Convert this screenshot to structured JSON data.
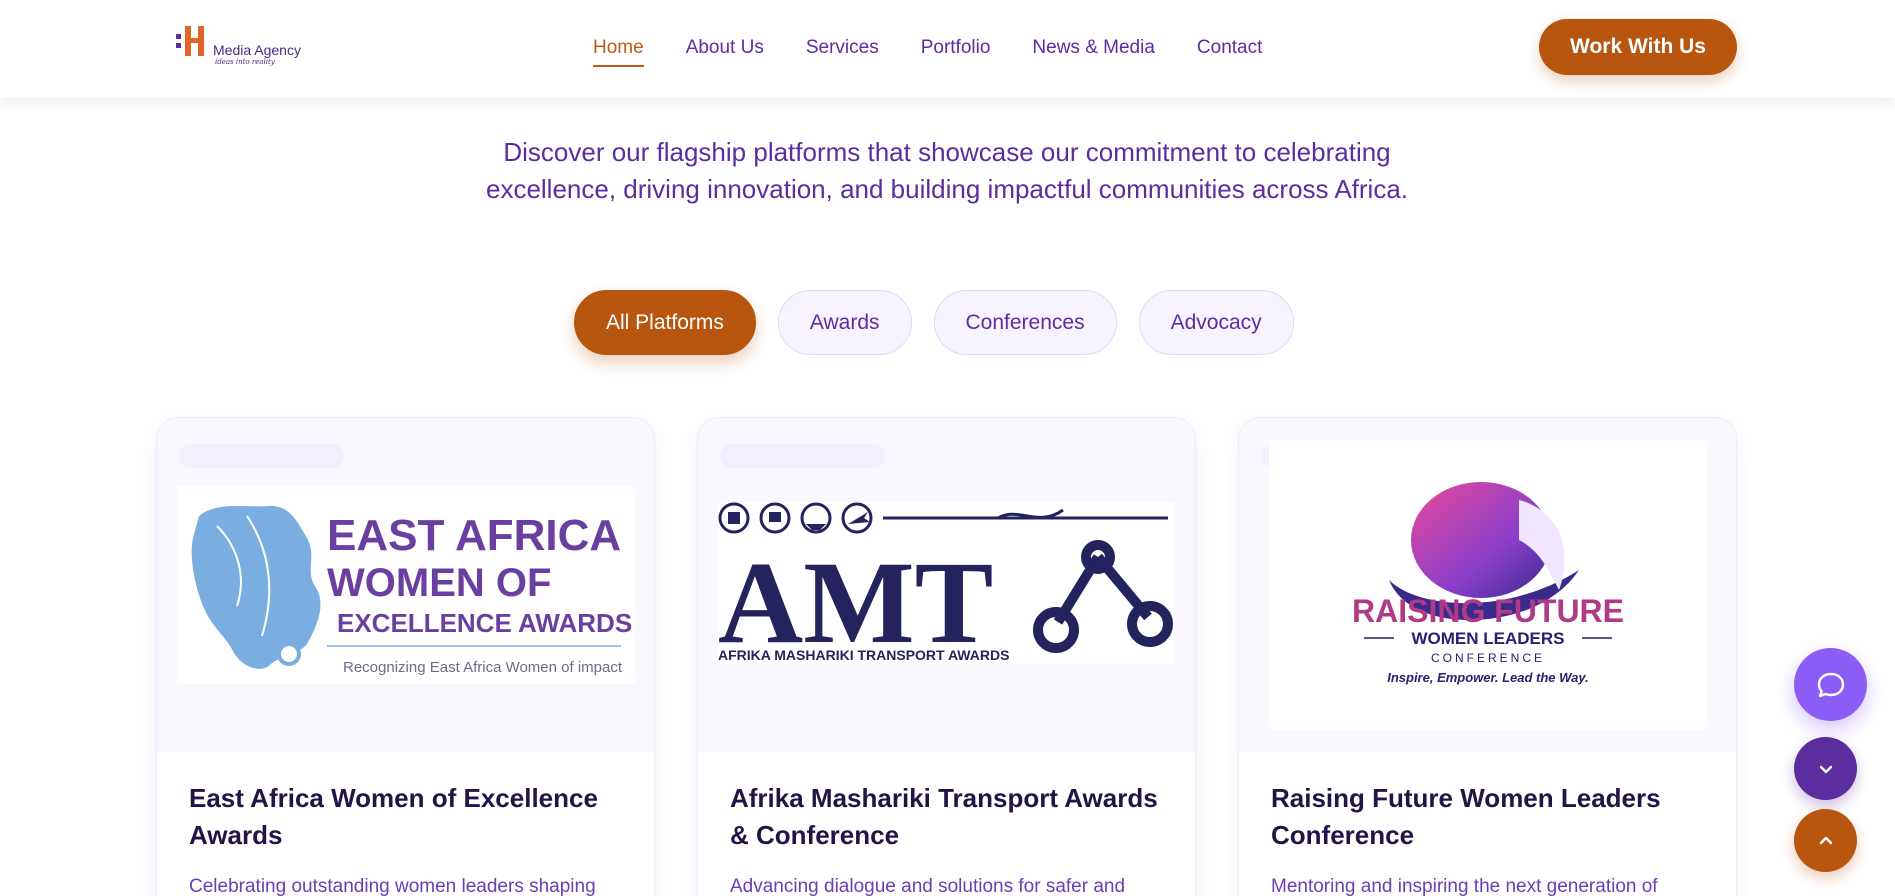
{
  "header": {
    "logo": {
      "name": "Media Agency",
      "tagline": "ideas into reality",
      "mark": "BH"
    },
    "nav": [
      {
        "label": "Home",
        "active": true
      },
      {
        "label": "About Us",
        "active": false
      },
      {
        "label": "Services",
        "active": false
      },
      {
        "label": "Portfolio",
        "active": false
      },
      {
        "label": "News & Media",
        "active": false
      },
      {
        "label": "Contact",
        "active": false
      }
    ],
    "cta_label": "Work With Us"
  },
  "intro": {
    "line1": "Discover our flagship platforms that showcase our commitment to celebrating",
    "line2": "excellence, driving innovation, and building impactful communities across Africa."
  },
  "filters": [
    {
      "label": "All Platforms",
      "active": true
    },
    {
      "label": "Awards",
      "active": false
    },
    {
      "label": "Conferences",
      "active": false
    },
    {
      "label": "Advocacy",
      "active": false
    }
  ],
  "cards": [
    {
      "title": "East Africa Women of Excellence Awards",
      "description": "Celebrating outstanding women leaders shaping",
      "logo": {
        "line1": "EAST AFRICA",
        "line2": "WOMEN  OF",
        "line3": "EXCELLENCE AWARDS",
        "tagline": "Recognizing East Africa Women of impact"
      }
    },
    {
      "title": "Afrika Mashariki Transport Awards & Conference",
      "description": "Advancing dialogue and solutions for safer and",
      "logo": {
        "acronym": "AMT",
        "subtitle": "AFRIKA MASHARIKI TRANSPORT AWARDS"
      }
    },
    {
      "title": "Raising Future Women Leaders Conference",
      "description": "Mentoring and inspiring the next generation of",
      "logo": {
        "line1": "RAISING FUTURE",
        "line2": "WOMEN LEADERS",
        "line3": "CONFERENCE",
        "tagline": "Inspire, Empower. Lead the Way."
      }
    }
  ],
  "colors": {
    "accent": "#b8550f",
    "primary": "#5b2d9f",
    "chat": "#8b5cf6",
    "ink": "#231445"
  },
  "fabs": {
    "chat": "chat-bubble-icon",
    "down": "chevron-down-icon",
    "up": "chevron-up-icon"
  }
}
